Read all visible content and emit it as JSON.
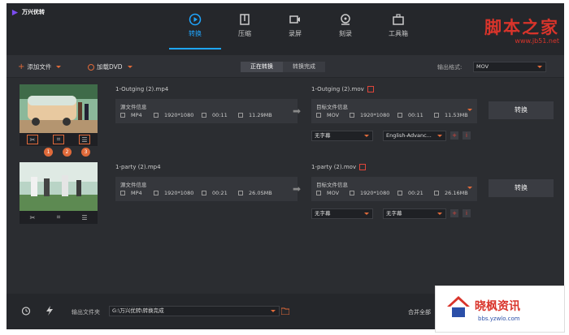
{
  "app": {
    "title": "万兴优转"
  },
  "nav": [
    {
      "label": "转换",
      "active": true,
      "icon": "convert-icon"
    },
    {
      "label": "压缩",
      "active": false,
      "icon": "compress-icon"
    },
    {
      "label": "录屏",
      "active": false,
      "icon": "record-icon"
    },
    {
      "label": "刻录",
      "active": false,
      "icon": "burn-icon"
    },
    {
      "label": "工具箱",
      "active": false,
      "icon": "toolbox-icon"
    }
  ],
  "watermark": {
    "text": "脚本之家",
    "url": "www.jb51.net"
  },
  "toolbar": {
    "add_file": "添加文件",
    "load_dvd": "加载DVD",
    "tab_converting": "正在转换",
    "tab_done": "转换完成",
    "output_format_label": "输出格式:",
    "output_format_value": "MOV"
  },
  "tasks": [
    {
      "source_name": "1-Outging (2).mp4",
      "source_info_label": "源文件信息",
      "source_format": "MP4",
      "source_res": "1920*1080",
      "source_dur": "00:11",
      "source_size": "11.29MB",
      "target_name": "1-Outging (2).mov",
      "target_info_label": "目标文件信息",
      "target_format": "MOV",
      "target_res": "1920*1080",
      "target_dur": "00:11",
      "target_size": "11.53MB",
      "subtitle": "无字幕",
      "audio": "English-Advanc...",
      "convert_label": "转换",
      "steps": [
        "1",
        "2",
        "3"
      ]
    },
    {
      "source_name": "1-party (2).mp4",
      "source_info_label": "源文件信息",
      "source_format": "MP4",
      "source_res": "1920*1080",
      "source_dur": "00:21",
      "source_size": "26.0SMB",
      "target_name": "1-party (2).mov",
      "target_info_label": "目标文件信息",
      "target_format": "MOV",
      "target_res": "1920*1080",
      "target_dur": "00:21",
      "target_size": "26.16MB",
      "subtitle": "无字幕",
      "audio": "无字幕",
      "convert_label": "转换"
    }
  ],
  "footer": {
    "output_folder_label": "输出文件夹",
    "output_folder_value": "G:\\万兴优转\\转换完成",
    "merge_label": "合并全部"
  },
  "badge": {
    "title": "晓枫资讯",
    "url": "bbs.yzwlo.com"
  },
  "colors": {
    "accent": "#1fa6ff",
    "orange": "#e06a3a",
    "red": "#e0453a"
  }
}
